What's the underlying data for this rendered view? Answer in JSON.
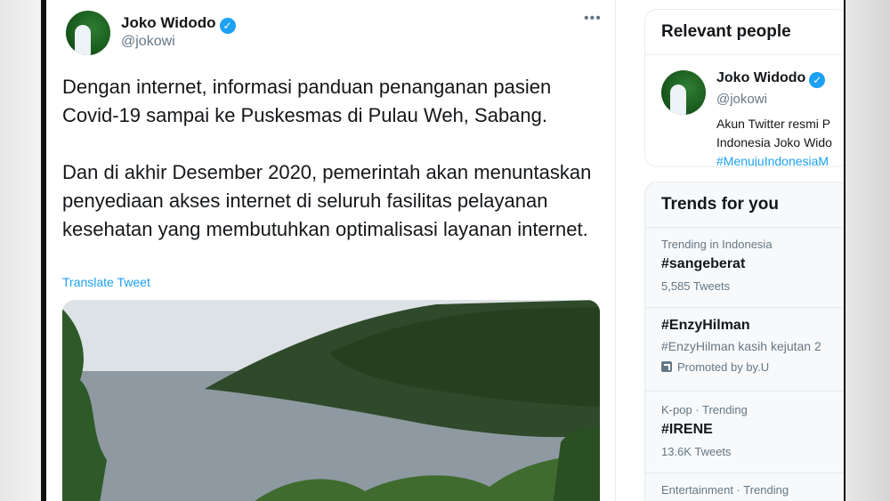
{
  "tweet": {
    "author_name": "Joko Widodo",
    "author_handle": "@jokowi",
    "more_label": "•••",
    "paragraphs": [
      "Dengan internet, informasi panduan penanganan pasien Covid-19 sampai ke Puskesmas di Pulau Weh, Sabang.",
      "Dan di akhir Desember 2020, pemerintah akan menuntaskan penyediaan akses internet di seluruh fasilitas pelayanan kesehatan yang membutuhkan optimalisasi layanan internet."
    ],
    "translate_label": "Translate Tweet"
  },
  "relevant_people": {
    "title": "Relevant people",
    "person": {
      "name": "Joko Widodo",
      "handle": "@jokowi",
      "bio_line1": "Akun Twitter resmi P",
      "bio_line2": "Indonesia Joko Wido",
      "bio_hashtag": "#MenujuIndonesiaM"
    }
  },
  "trends": {
    "title": "Trends for you",
    "items": [
      {
        "meta": "Trending in Indonesia",
        "name": "#sangeberat",
        "sub": "5,585 Tweets"
      },
      {
        "name": "#EnzyHilman",
        "description": "#EnzyHilman kasih kejutan 2",
        "promoted": "Promoted by by.U"
      },
      {
        "meta": "K-pop · Trending",
        "name": "#IRENE",
        "sub": "13.6K Tweets"
      },
      {
        "meta": "Entertainment · Trending"
      }
    ]
  },
  "colors": {
    "accent": "#1da1f2",
    "text_primary": "#14171a",
    "text_secondary": "#657786"
  },
  "icons": [
    "verified-badge-icon",
    "more-options-icon",
    "promoted-icon"
  ]
}
